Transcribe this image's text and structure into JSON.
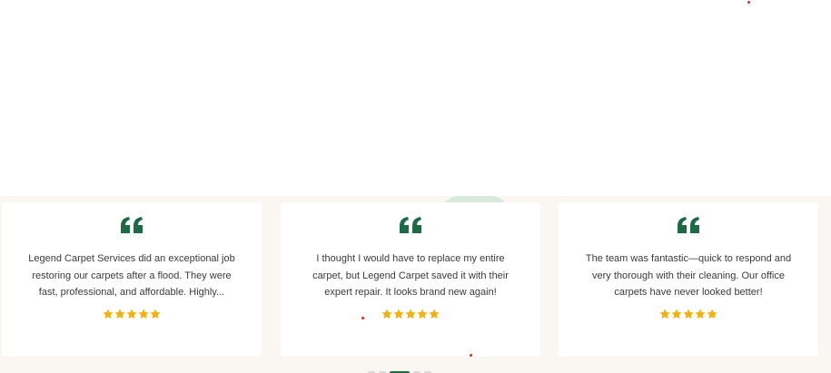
{
  "colors": {
    "accent": "#1c6b45",
    "star": "#f3b10b",
    "text": "#3a3a3a",
    "section_bg": "#faf6f2"
  },
  "testimonials": [
    {
      "quote_icon": "quote-icon",
      "text": "Legend Carpet Services did an exceptional job restoring our carpets after a flood. They were fast, professional, and affordable. Highly...",
      "rating": 5
    },
    {
      "quote_icon": "quote-icon",
      "text": "I thought I would have to replace my entire carpet, but Legend Carpet saved it with their expert repair. It looks brand new again!",
      "rating": 5
    },
    {
      "quote_icon": "quote-icon",
      "text": "The team was fantastic—quick to respond and very thorough with their cleaning. Our office carpets have never looked better!",
      "rating": 5
    }
  ],
  "pagination": {
    "count": 5,
    "active_index": 2
  }
}
